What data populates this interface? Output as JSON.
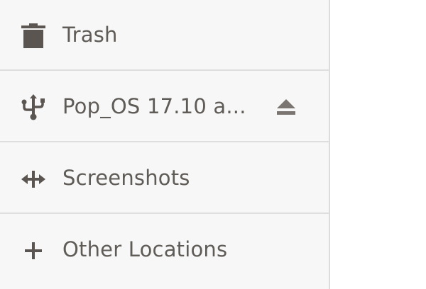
{
  "sidebar": {
    "items": [
      {
        "label": "Trash",
        "icon": "trash-icon"
      },
      {
        "label": "Pop_OS 17.10 a...",
        "icon": "usb-icon",
        "action_icon": "eject-icon"
      },
      {
        "label": "Screenshots",
        "icon": "folder-network-icon"
      },
      {
        "label": "Other Locations",
        "icon": "plus-icon"
      }
    ]
  },
  "colors": {
    "sidebar_bg": "#f7f7f7",
    "text": "#5f5b57",
    "icon": "#5a5550",
    "divider": "#dedede"
  }
}
